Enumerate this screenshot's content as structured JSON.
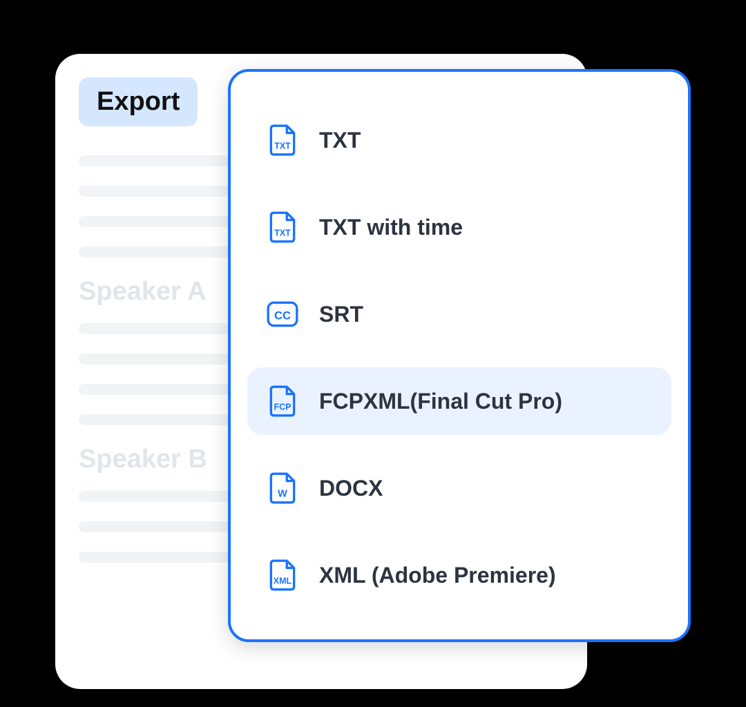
{
  "colors": {
    "accent": "#1a73ff",
    "highlight_bg": "#eaf2ff",
    "export_bg": "#d5e7ff"
  },
  "export_button": {
    "label": "Export"
  },
  "background_panel": {
    "speakers": [
      "Speaker A",
      "Speaker B"
    ]
  },
  "export_menu": {
    "items": [
      {
        "icon": "file-txt-icon",
        "icon_text": "TXT",
        "label": "TXT",
        "highlighted": false
      },
      {
        "icon": "file-txt-icon",
        "icon_text": "TXT",
        "label": "TXT with time",
        "highlighted": false
      },
      {
        "icon": "cc-icon",
        "icon_text": "CC",
        "label": "SRT",
        "highlighted": false
      },
      {
        "icon": "file-fcp-icon",
        "icon_text": "FCP",
        "label": "FCPXML(Final Cut Pro)",
        "highlighted": true
      },
      {
        "icon": "file-docx-icon",
        "icon_text": "W",
        "label": "DOCX",
        "highlighted": false
      },
      {
        "icon": "file-xml-icon",
        "icon_text": "XML",
        "label": "XML (Adobe Premiere)",
        "highlighted": false
      }
    ]
  }
}
